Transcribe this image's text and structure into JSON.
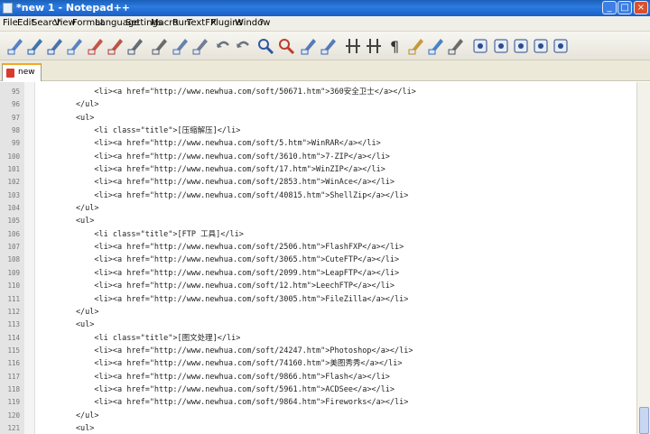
{
  "window": {
    "title": "*new 1 - Notepad++"
  },
  "menu": [
    "File",
    "Edit",
    "Search",
    "View",
    "Format",
    "Language",
    "Settings",
    "Macro",
    "Run",
    "TextFX",
    "Plugins",
    "Window",
    "?"
  ],
  "toolbar_icons": [
    "new-file-icon",
    "open-file-icon",
    "save-icon",
    "save-all-icon",
    "close-icon",
    "close-all-icon",
    "print-icon",
    "cut-icon",
    "copy-icon",
    "paste-icon",
    "undo-icon",
    "redo-icon",
    "find-icon",
    "replace-icon",
    "zoom-in-icon",
    "zoom-out-icon",
    "sync-vertical-icon",
    "sync-horizontal-icon",
    "word-wrap-icon",
    "show-all-chars-icon",
    "indent-guide-icon",
    "user-lang-icon",
    "record-macro-icon",
    "stop-macro-icon",
    "play-macro-icon",
    "play-multiple-icon",
    "save-macro-icon"
  ],
  "tabs": [
    {
      "label": "new 1",
      "active": true
    }
  ],
  "editor": {
    "lines": [
      {
        "num": "95",
        "code": "            <li><a href=\"http://www.newhua.com/soft/50671.htm\">360安全卫士</a></li>"
      },
      {
        "num": "96",
        "code": "        </ul>"
      },
      {
        "num": "97",
        "code": "        <ul>"
      },
      {
        "num": "98",
        "code": "            <li class=\"title\">[压缩解压]</li>"
      },
      {
        "num": "99",
        "code": "            <li><a href=\"http://www.newhua.com/soft/5.htm\">WinRAR</a></li>"
      },
      {
        "num": "100",
        "code": "            <li><a href=\"http://www.newhua.com/soft/3610.htm\">7-ZIP</a></li>"
      },
      {
        "num": "101",
        "code": "            <li><a href=\"http://www.newhua.com/soft/17.htm\">WinZIP</a></li>"
      },
      {
        "num": "102",
        "code": "            <li><a href=\"http://www.newhua.com/soft/2853.htm\">WinAce</a></li>"
      },
      {
        "num": "103",
        "code": "            <li><a href=\"http://www.newhua.com/soft/40815.htm\">ShellZip</a></li>"
      },
      {
        "num": "104",
        "code": "        </ul>"
      },
      {
        "num": "105",
        "code": "        <ul>"
      },
      {
        "num": "106",
        "code": "            <li class=\"title\">[FTP 工具]</li>"
      },
      {
        "num": "107",
        "code": "            <li><a href=\"http://www.newhua.com/soft/2506.htm\">FlashFXP</a></li>"
      },
      {
        "num": "108",
        "code": "            <li><a href=\"http://www.newhua.com/soft/3065.htm\">CuteFTP</a></li>"
      },
      {
        "num": "109",
        "code": "            <li><a href=\"http://www.newhua.com/soft/2099.htm\">LeapFTP</a></li>"
      },
      {
        "num": "110",
        "code": "            <li><a href=\"http://www.newhua.com/soft/12.htm\">LeechFTP</a></li>"
      },
      {
        "num": "111",
        "code": "            <li><a href=\"http://www.newhua.com/soft/3005.htm\">FileZilla</a></li>"
      },
      {
        "num": "112",
        "code": "        </ul>"
      },
      {
        "num": "113",
        "code": "        <ul>"
      },
      {
        "num": "114",
        "code": "            <li class=\"title\">[图文处理]</li>"
      },
      {
        "num": "115",
        "code": "            <li><a href=\"http://www.newhua.com/soft/24247.htm\">Photoshop</a></li>"
      },
      {
        "num": "116",
        "code": "            <li><a href=\"http://www.newhua.com/soft/74160.htm\">美图秀秀</a></li>"
      },
      {
        "num": "117",
        "code": "            <li><a href=\"http://www.newhua.com/soft/9866.htm\">Flash</a></li>"
      },
      {
        "num": "118",
        "code": "            <li><a href=\"http://www.newhua.com/soft/5961.htm\">ACDSee</a></li>"
      },
      {
        "num": "119",
        "code": "            <li><a href=\"http://www.newhua.com/soft/9864.htm\">Fireworks</a></li>"
      },
      {
        "num": "120",
        "code": "        </ul>"
      },
      {
        "num": "121",
        "code": "        <ul>"
      }
    ]
  },
  "colors": {
    "titlebar": "#2b7be0",
    "tab_accent": "#f6a623",
    "gutter": "#e4e4e4"
  }
}
